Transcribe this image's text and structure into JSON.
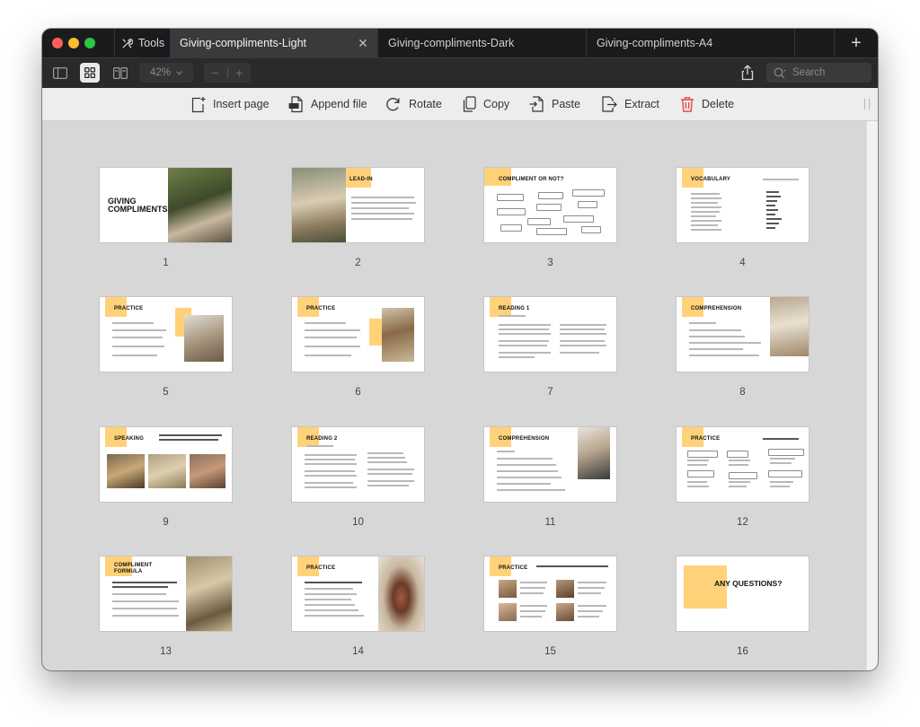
{
  "tabs": {
    "tools_label": "Tools",
    "items": [
      {
        "label": "Giving-compliments-Light"
      },
      {
        "label": "Giving-compliments-Dark"
      },
      {
        "label": "Giving-compliments-A4"
      }
    ]
  },
  "viewbar": {
    "zoom": "42%",
    "zoom_out": "−",
    "zoom_in": "+",
    "search_placeholder": "Search"
  },
  "actions": {
    "insert_page": "Insert page",
    "append_file": "Append file",
    "rotate": "Rotate",
    "copy": "Copy",
    "paste": "Paste",
    "extract": "Extract",
    "delete": "Delete"
  },
  "colors": {
    "accent_yellow": "#ffd27a",
    "delete_red": "#e5484d",
    "active_tab": "#3a3a3d"
  },
  "pages": [
    {
      "number": "1",
      "title": "GIVING\nCOMPLIMENTS"
    },
    {
      "number": "2",
      "title": "LEAD-IN"
    },
    {
      "number": "3",
      "title": "COMPLIMENT OR NOT?"
    },
    {
      "number": "4",
      "title": "VOCABULARY"
    },
    {
      "number": "5",
      "title": "PRACTICE"
    },
    {
      "number": "6",
      "title": "PRACTICE"
    },
    {
      "number": "7",
      "title": "READING 1"
    },
    {
      "number": "8",
      "title": "COMPREHENSION"
    },
    {
      "number": "9",
      "title": "SPEAKING"
    },
    {
      "number": "10",
      "title": "READING 2"
    },
    {
      "number": "11",
      "title": "COMPREHENSION"
    },
    {
      "number": "12",
      "title": "PRACTICE"
    },
    {
      "number": "13",
      "title": "COMPLIMENT\nFORMULA"
    },
    {
      "number": "14",
      "title": "PRACTICE"
    },
    {
      "number": "15",
      "title": "PRACTICE"
    },
    {
      "number": "16",
      "title": "ANY QUESTIONS?"
    }
  ]
}
